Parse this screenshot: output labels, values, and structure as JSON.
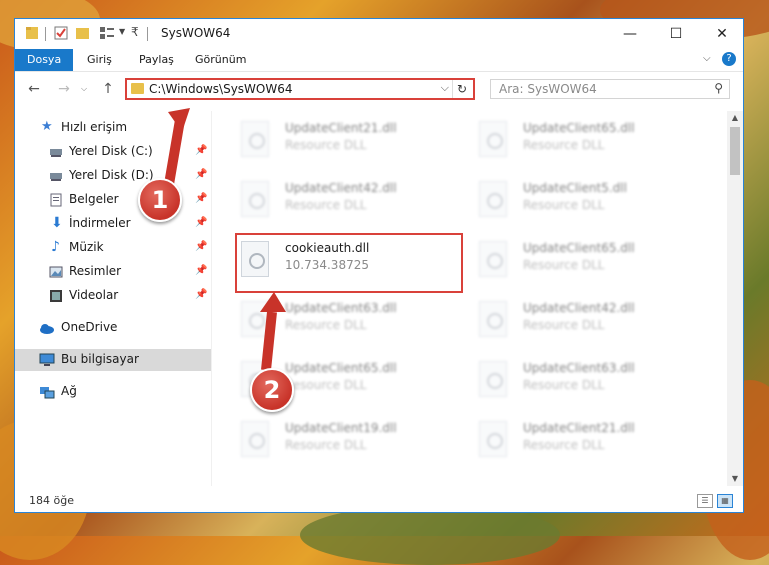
{
  "window": {
    "title": "SysWOW64",
    "controls": {
      "minimize": "—",
      "maximize": "☐",
      "close": "✕"
    }
  },
  "ribbon": {
    "tabs": [
      {
        "label": "Dosya",
        "active": true
      },
      {
        "label": "Giriş",
        "active": false
      },
      {
        "label": "Paylaş",
        "active": false
      },
      {
        "label": "Görünüm",
        "active": false
      }
    ],
    "expand_icon": "chevron-down-icon",
    "help_icon": "help-icon"
  },
  "address": {
    "path": "C:\\Windows\\SysWOW64",
    "folder_icon": "folder-icon",
    "refresh_icon": "refresh-icon"
  },
  "search": {
    "placeholder": "Ara: SysWOW64",
    "icon": "search-icon"
  },
  "sidebar": {
    "items": [
      {
        "label": "Hızlı erişim",
        "icon": "star-icon",
        "pinned": false,
        "selected": false
      },
      {
        "label": "Yerel Disk (C:)",
        "icon": "drive-icon",
        "pinned": true,
        "selected": false
      },
      {
        "label": "Yerel Disk (D:)",
        "icon": "drive-icon",
        "pinned": true,
        "selected": false
      },
      {
        "label": "Belgeler",
        "icon": "documents-icon",
        "pinned": true,
        "selected": false
      },
      {
        "label": "İndirmeler",
        "icon": "download-icon",
        "pinned": true,
        "selected": false
      },
      {
        "label": "Müzik",
        "icon": "music-icon",
        "pinned": true,
        "selected": false
      },
      {
        "label": "Resimler",
        "icon": "pictures-icon",
        "pinned": true,
        "selected": false
      },
      {
        "label": "Videolar",
        "icon": "videos-icon",
        "pinned": true,
        "selected": false
      },
      {
        "label": "OneDrive",
        "icon": "cloud-icon",
        "pinned": false,
        "selected": false
      },
      {
        "label": "Bu bilgisayar",
        "icon": "computer-icon",
        "pinned": false,
        "selected": true
      },
      {
        "label": "Ağ",
        "icon": "network-icon",
        "pinned": false,
        "selected": false
      }
    ]
  },
  "files": {
    "left": [
      {
        "name": "UpdateClient21.dll",
        "desc": "Resource DLL"
      },
      {
        "name": "UpdateClient42.dll",
        "desc": "Resource DLL"
      },
      {
        "name": "cookieauth.dll",
        "desc": "10.734.38725"
      },
      {
        "name": "UpdateClient63.dll",
        "desc": "Resource DLL"
      },
      {
        "name": "UpdateClient65.dll",
        "desc": "Resource DLL"
      },
      {
        "name": "UpdateClient19.dll",
        "desc": "Resource DLL"
      }
    ],
    "right": [
      {
        "name": "UpdateClient65.dll",
        "desc": "Resource DLL"
      },
      {
        "name": "UpdateClient5.dll",
        "desc": "Resource DLL"
      },
      {
        "name": "UpdateClient65.dll",
        "desc": "Resource DLL"
      },
      {
        "name": "UpdateClient42.dll",
        "desc": "Resource DLL"
      },
      {
        "name": "UpdateClient63.dll",
        "desc": "Resource DLL"
      },
      {
        "name": "UpdateClient21.dll",
        "desc": "Resource DLL"
      }
    ]
  },
  "status": {
    "count": "184 öğe"
  },
  "markers": {
    "one": "1",
    "two": "2"
  },
  "colors": {
    "accent": "#1979ca",
    "highlight": "#d9413a",
    "selected": "#d9d9d9"
  }
}
